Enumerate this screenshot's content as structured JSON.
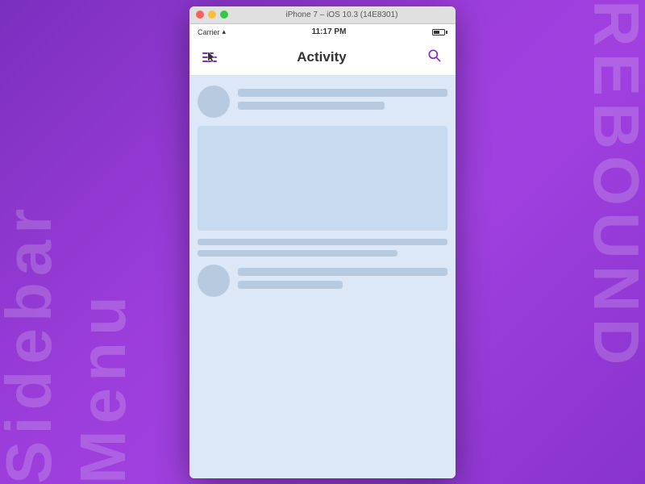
{
  "background": {
    "left_text": "Sidebar Menu",
    "right_text": "REBOUND"
  },
  "device": {
    "title_bar_label": "iPhone 7 – iOS 10.3 (14E8301)"
  },
  "status_bar": {
    "carrier": "Carrier",
    "wifi_symbol": "▲",
    "time": "11:17 PM"
  },
  "nav_bar": {
    "title": "Activity",
    "search_icon_label": "search-icon"
  },
  "content": {
    "placeholder_note": "Loading skeleton content"
  }
}
